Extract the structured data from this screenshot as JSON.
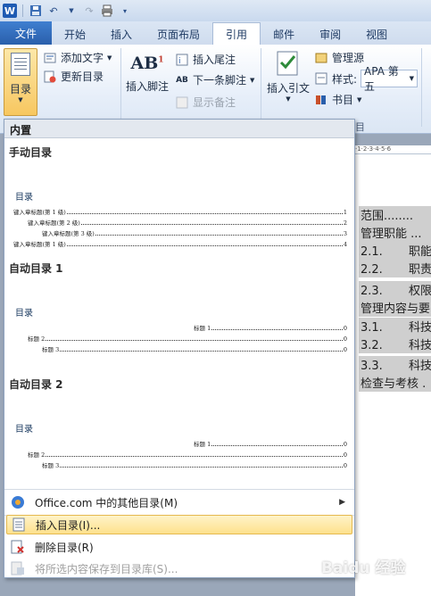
{
  "app": {
    "logo": "W"
  },
  "tabs": [
    {
      "label": "文件"
    },
    {
      "label": "开始"
    },
    {
      "label": "插入"
    },
    {
      "label": "页面布局"
    },
    {
      "label": "引用"
    },
    {
      "label": "邮件"
    },
    {
      "label": "审阅"
    },
    {
      "label": "视图"
    }
  ],
  "ribbon": {
    "toc_button": "目录",
    "add_text": "添加文字",
    "update_toc": "更新目录",
    "insert_footnote": "插入脚注",
    "insert_endnote": "插入尾注",
    "next_footnote": "下一条脚注",
    "show_notes": "显示备注",
    "insert_citation": "插入引文",
    "manage_sources": "管理源",
    "style_label": "样式:",
    "style_value": "APA 第五",
    "bibliography": "书目",
    "group_fragment": "目"
  },
  "menu": {
    "header": "内置",
    "manual": {
      "title": "手动目录",
      "heading": "目录",
      "entries": [
        {
          "text": "键入章标题(第 1 级)",
          "page": "1"
        },
        {
          "text": "键入章标题(第 2 级)",
          "page": "2"
        },
        {
          "text": "键入章标题(第 3 级)",
          "page": "3"
        },
        {
          "text": "键入章标题(第 1 级)",
          "page": "4"
        }
      ]
    },
    "auto1": {
      "title": "自动目录 1",
      "heading": "目录",
      "entries": [
        {
          "text": "标题 1",
          "page": "0"
        },
        {
          "text": "标题 2",
          "page": "0"
        },
        {
          "text": "标题 3",
          "page": "0"
        }
      ]
    },
    "auto2": {
      "title": "自动目录 2",
      "heading": "目录",
      "entries": [
        {
          "text": "标题 1",
          "page": "0"
        },
        {
          "text": "标题 2",
          "page": "0"
        },
        {
          "text": "标题 3",
          "page": "0"
        }
      ]
    },
    "items": {
      "office_more": "Office.com 中的其他目录(M)",
      "insert_toc": "插入目录(I)...",
      "delete_toc": "删除目录(R)",
      "save_selection": "将所选内容保存到目录库(S)..."
    }
  },
  "document": {
    "ruler": "·1·2·3·4·5·6",
    "lines": [
      {
        "num": "",
        "text": "范围........"
      },
      {
        "num": "",
        "text": "管理职能 ..."
      },
      {
        "num": "2.1.",
        "text": "职能"
      },
      {
        "num": "2.2.",
        "text": "职责"
      },
      {
        "num": "2.3.",
        "text": "权限"
      },
      {
        "num": "",
        "text": "管理内容与要"
      },
      {
        "num": "3.1.",
        "text": "科技"
      },
      {
        "num": "3.2.",
        "text": "科技"
      },
      {
        "num": "3.3.",
        "text": "科技"
      },
      {
        "num": "",
        "text": "检查与考核 ."
      }
    ]
  },
  "watermark": "Baidu 经验"
}
